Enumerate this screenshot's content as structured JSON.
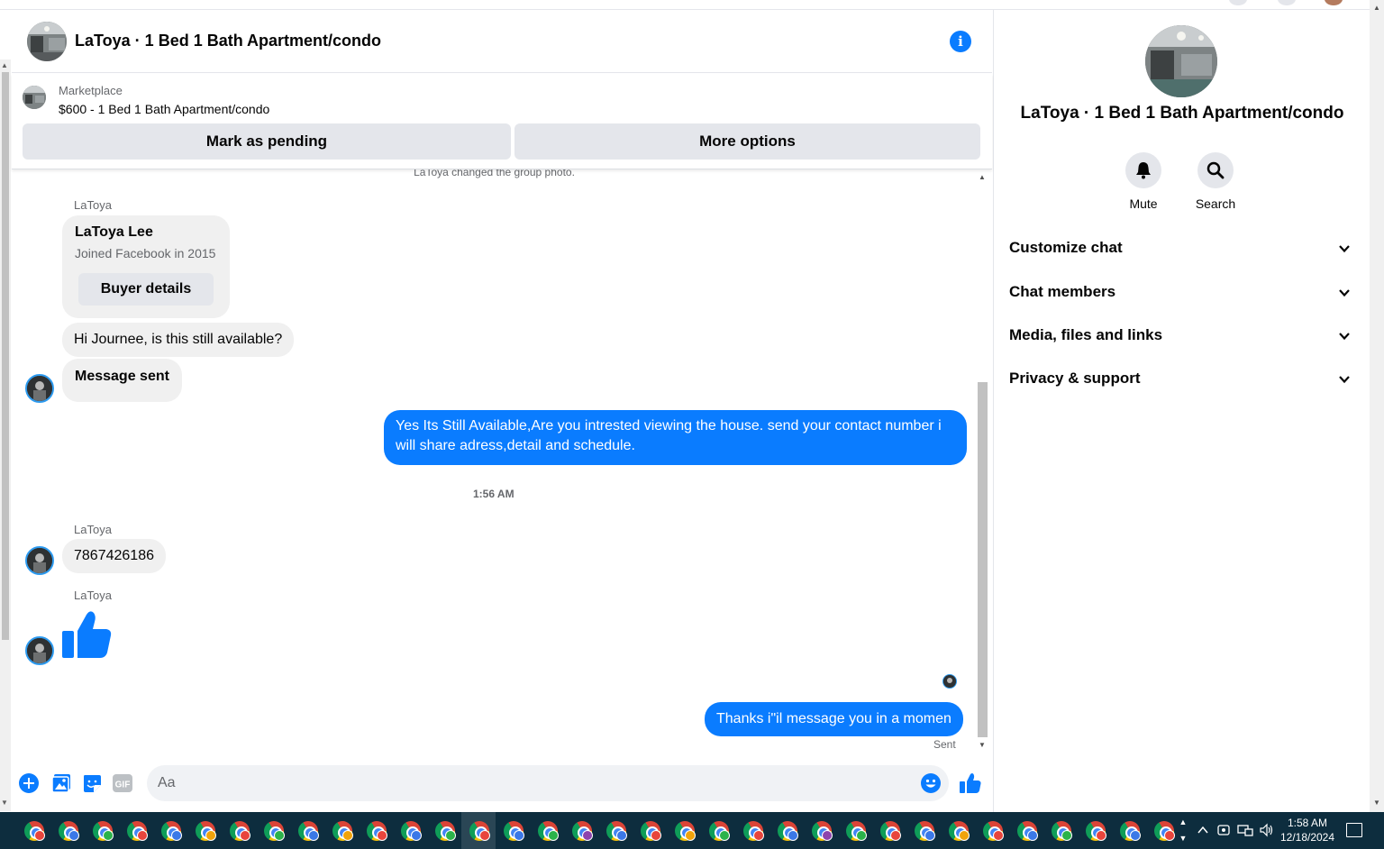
{
  "header": {
    "title": "LaToya · 1 Bed 1 Bath Apartment/condo"
  },
  "marketplace": {
    "label": "Marketplace",
    "listing": "$600 - 1 Bed 1 Bath Apartment/condo",
    "pending_label": "Mark as pending",
    "more_label": "More options"
  },
  "messages": {
    "system_note": "LaToya changed the group photo.",
    "sender_1": "LaToya",
    "buyer_card": {
      "name": "LaToya Lee",
      "sub": "Joined Facebook in 2015",
      "button": "Buyer details"
    },
    "msg_1": "Hi Journee, is this still available?",
    "msg_2": "Message sent",
    "reply_1": "Yes Its Still Available,Are you intrested viewing the house. send your contact number i will share adress,detail and schedule.",
    "time_1": "1:56 AM",
    "sender_2": "LaToya",
    "msg_3": "7867426186",
    "sender_3": "LaToya",
    "reply_2": "Thanks i\"il message you in a momen",
    "status": "Sent"
  },
  "composer": {
    "placeholder": "Aa",
    "gif_label": "GIF"
  },
  "right_panel": {
    "title": "LaToya · 1 Bed 1 Bath Apartment/condo",
    "actions": [
      "Mute",
      "Search"
    ],
    "sections": [
      "Customize chat",
      "Chat members",
      "Media, files and links",
      "Privacy & support"
    ]
  },
  "taskbar": {
    "time": "1:58 AM",
    "date": "12/18/2024"
  },
  "colors": {
    "accent": "#0a7cff",
    "bubble_in": "#f0f0f0",
    "taskbar": "#0d2d3e"
  },
  "icons": [
    "info-icon",
    "add-icon",
    "image-icon",
    "sticker-icon",
    "gif-icon",
    "emoji-icon",
    "like-icon",
    "bell-icon",
    "search-icon",
    "chevron-down-icon",
    "chrome-icon"
  ]
}
